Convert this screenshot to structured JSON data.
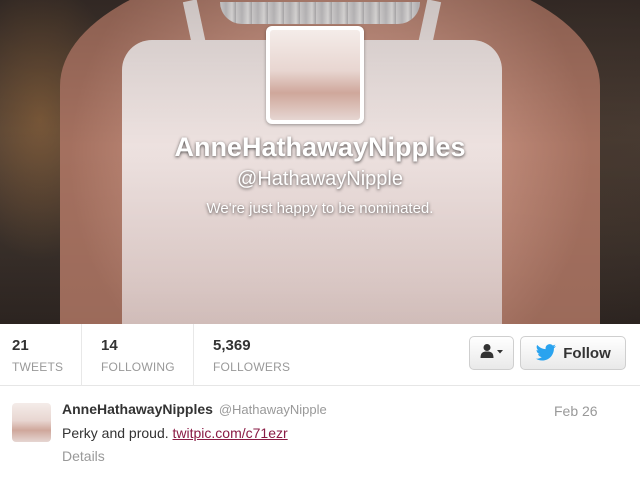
{
  "profile": {
    "display_name": "AnneHathawayNipples",
    "handle": "@HathawayNipple",
    "bio": "We're just happy to be nominated."
  },
  "stats": {
    "tweets": {
      "value": "21",
      "label": "TWEETS"
    },
    "following": {
      "value": "14",
      "label": "FOLLOWING"
    },
    "followers": {
      "value": "5,369",
      "label": "FOLLOWERS"
    }
  },
  "actions": {
    "user_menu_icon": "person-dropdown-icon",
    "follow_label": "Follow",
    "follow_icon": "twitter-bird-icon"
  },
  "tweet": {
    "author": "AnneHathawayNipples",
    "handle": "@HathawayNipple",
    "date": "Feb 26",
    "text": "Perky and proud.",
    "link": "twitpic.com/c71ezr",
    "details_label": "Details"
  },
  "colors": {
    "link": "#8a1b44",
    "twitter_blue": "#2aa3ef",
    "muted_text": "#999999"
  }
}
